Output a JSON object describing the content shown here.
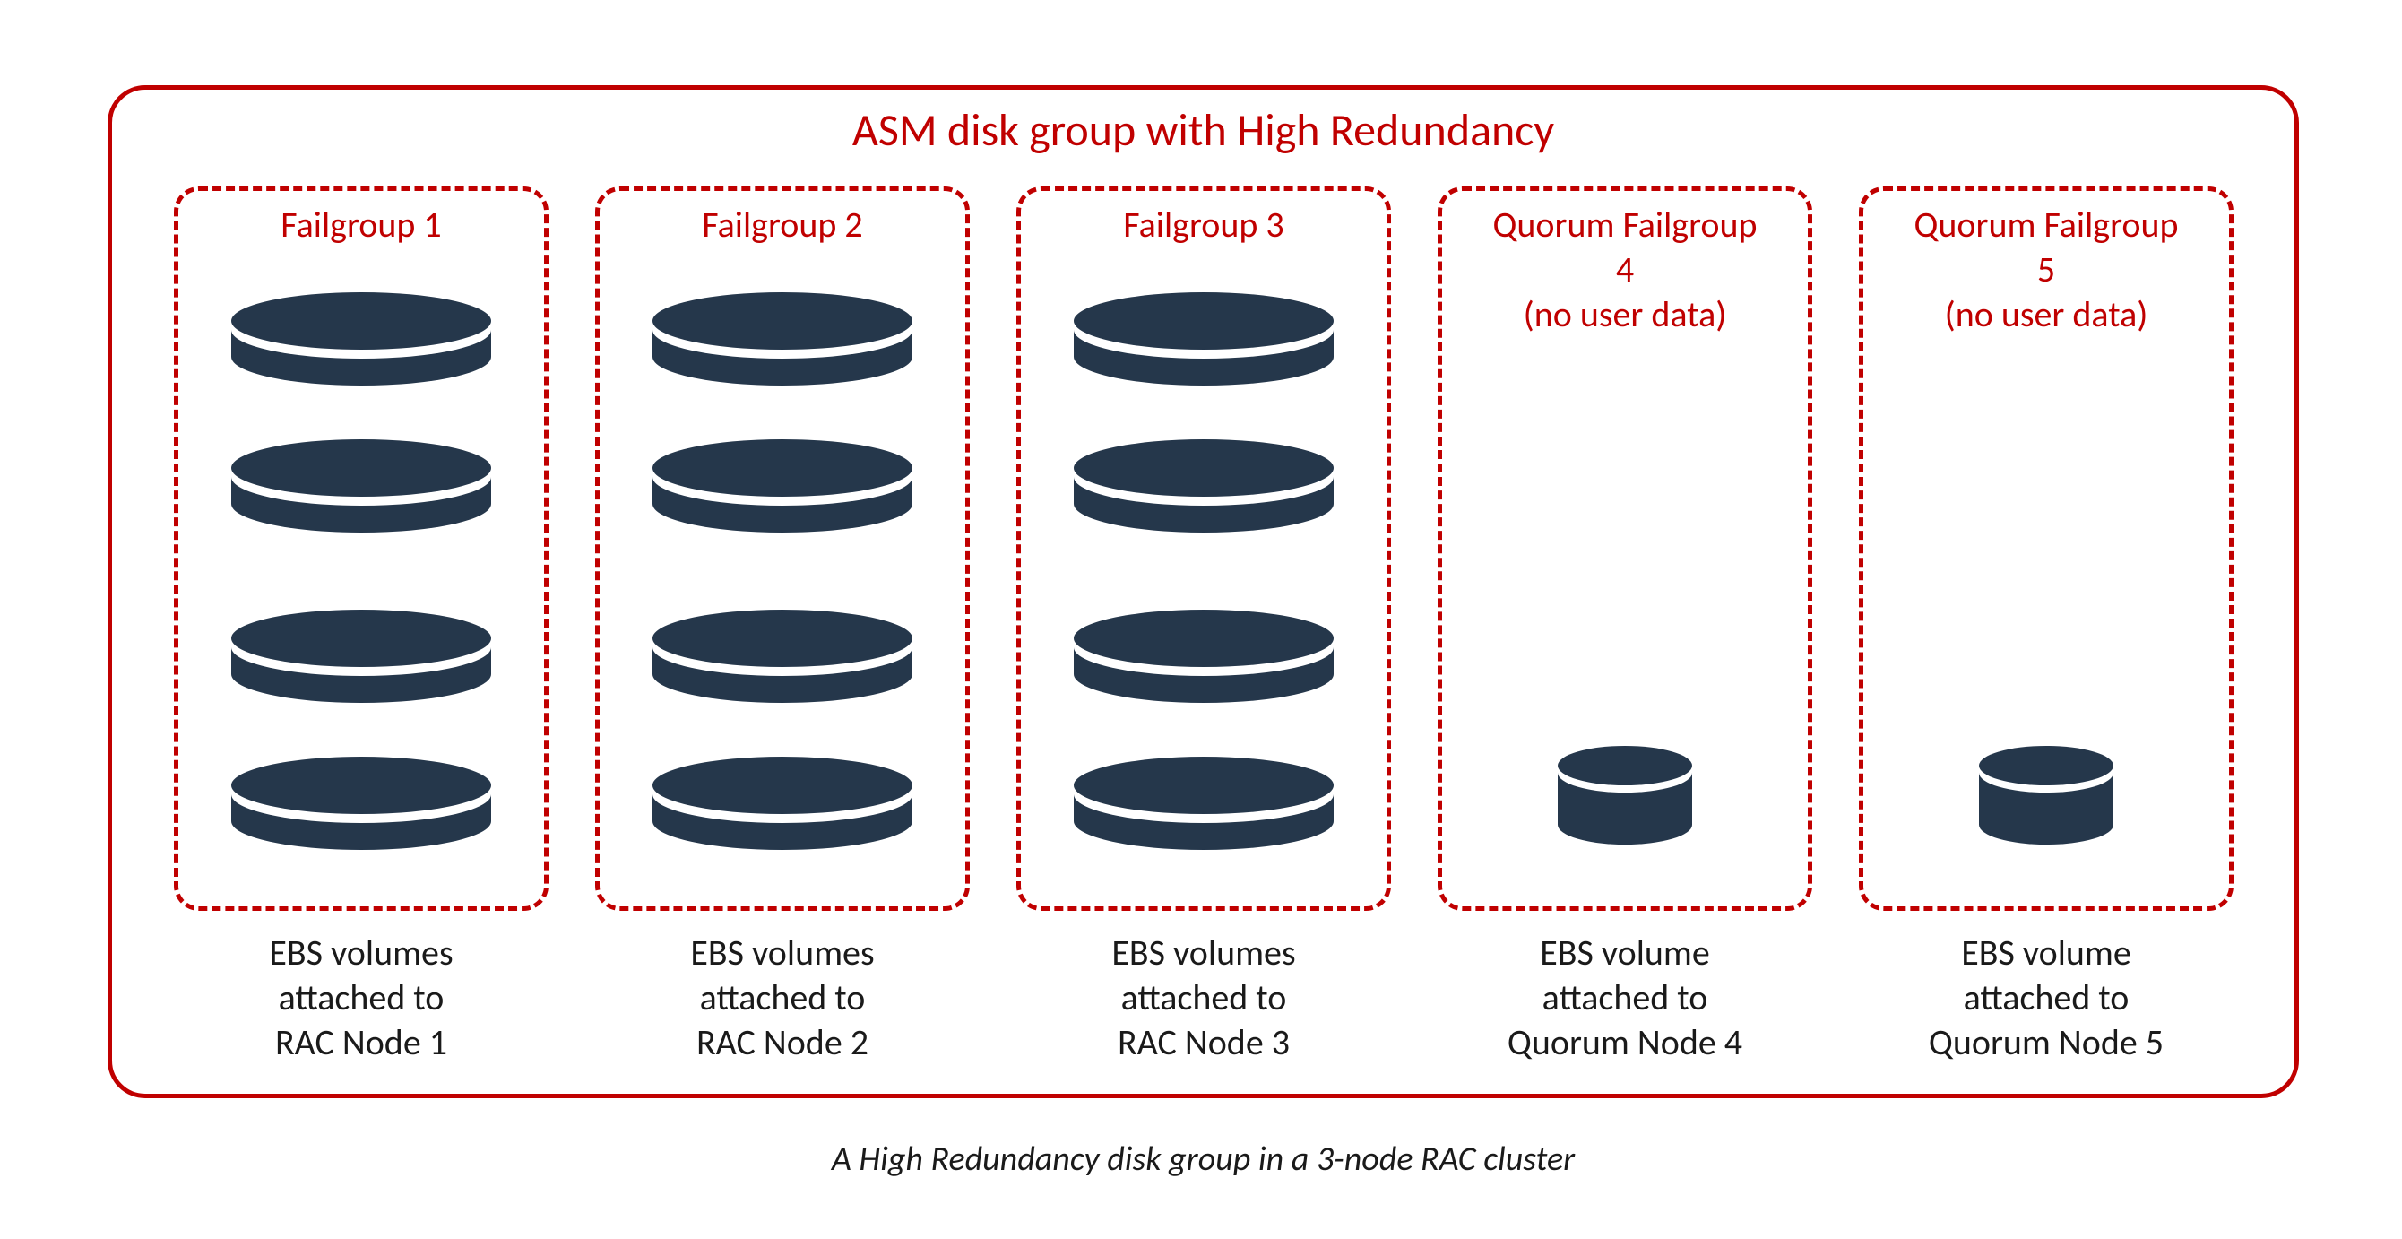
{
  "colors": {
    "accent": "#c00000",
    "disk": "#25374b",
    "text": "#1a1a1a"
  },
  "outer": {
    "title": "ASM disk group with High Redundancy"
  },
  "groups": [
    {
      "title": "Failgroup 1",
      "sub1": "",
      "sub2": "",
      "diskType": "big",
      "diskCount": 4,
      "captionLine1": "EBS volumes",
      "captionLine2": "attached to",
      "captionLine3": "RAC Node 1"
    },
    {
      "title": "Failgroup 2",
      "sub1": "",
      "sub2": "",
      "diskType": "big",
      "diskCount": 4,
      "captionLine1": "EBS volumes",
      "captionLine2": "attached to",
      "captionLine3": "RAC Node 2"
    },
    {
      "title": "Failgroup 3",
      "sub1": "",
      "sub2": "",
      "diskType": "big",
      "diskCount": 4,
      "captionLine1": "EBS volumes",
      "captionLine2": "attached to",
      "captionLine3": "RAC Node 3"
    },
    {
      "title": "Quorum Failgroup",
      "sub1": "4",
      "sub2": "(no user data)",
      "diskType": "small",
      "diskCount": 1,
      "captionLine1": "EBS volume",
      "captionLine2": "attached to",
      "captionLine3": "Quorum Node 4"
    },
    {
      "title": "Quorum Failgroup",
      "sub1": "5",
      "sub2": "(no user data)",
      "diskType": "small",
      "diskCount": 1,
      "captionLine1": "EBS volume",
      "captionLine2": "attached to",
      "captionLine3": "Quorum Node 5"
    }
  ],
  "figureCaption": "A High Redundancy disk group in a 3-node RAC cluster"
}
